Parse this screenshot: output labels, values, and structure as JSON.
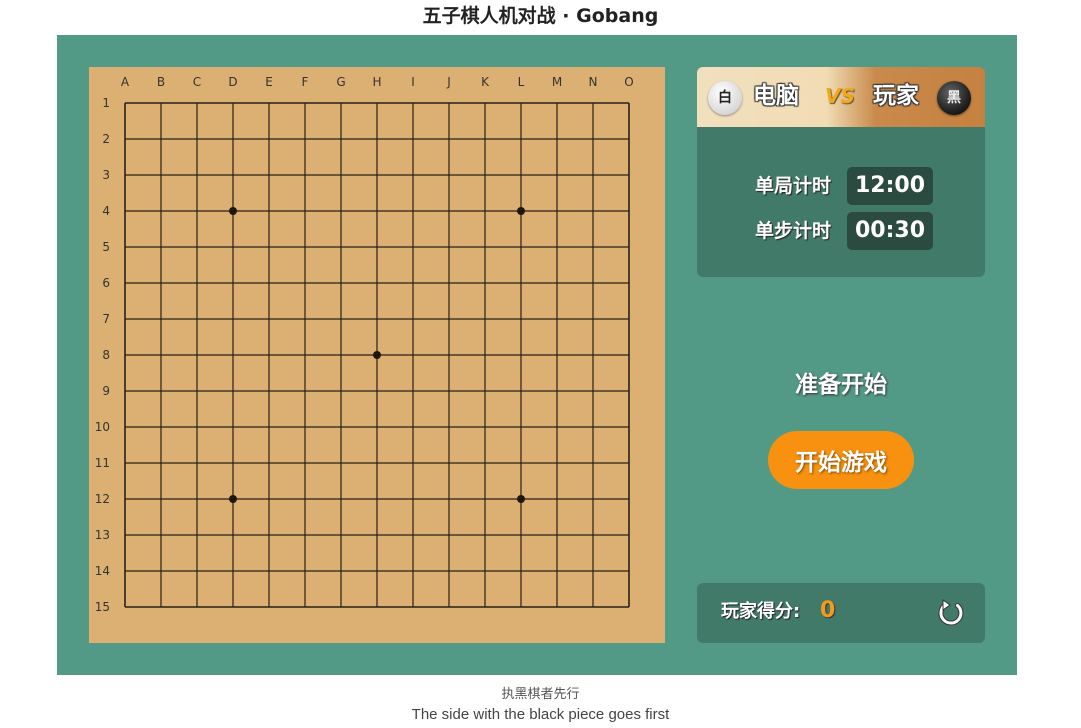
{
  "page": {
    "title": "五子棋人机对战 · Gobang",
    "footer_cn": "执黑棋者先行",
    "footer_en": "The side with the black piece goes first"
  },
  "board": {
    "columns": [
      "A",
      "B",
      "C",
      "D",
      "E",
      "F",
      "G",
      "H",
      "I",
      "J",
      "K",
      "L",
      "M",
      "N",
      "O"
    ],
    "rows": [
      "1",
      "2",
      "3",
      "4",
      "5",
      "6",
      "7",
      "8",
      "9",
      "10",
      "11",
      "12",
      "13",
      "14",
      "15"
    ],
    "star_points": [
      {
        "col": "D",
        "row": "4"
      },
      {
        "col": "L",
        "row": "4"
      },
      {
        "col": "H",
        "row": "8"
      },
      {
        "col": "D",
        "row": "12"
      },
      {
        "col": "L",
        "row": "12"
      }
    ],
    "stones": [],
    "colors": {
      "wood": "#dcb072",
      "line": "#2a2016",
      "panel": "#529a86"
    }
  },
  "players": {
    "computer": {
      "stone_label": "白",
      "name": "电脑"
    },
    "vs": "VS",
    "human": {
      "stone_label": "黑",
      "name": "玩家"
    }
  },
  "timers": {
    "game_label": "单局计时",
    "game_value": "12:00",
    "step_label": "单步计时",
    "step_value": "00:30"
  },
  "status": {
    "text": "准备开始"
  },
  "controls": {
    "start_label": "开始游戏",
    "accent": "#f7910f"
  },
  "score": {
    "label": "玩家得分:",
    "value": "0"
  }
}
